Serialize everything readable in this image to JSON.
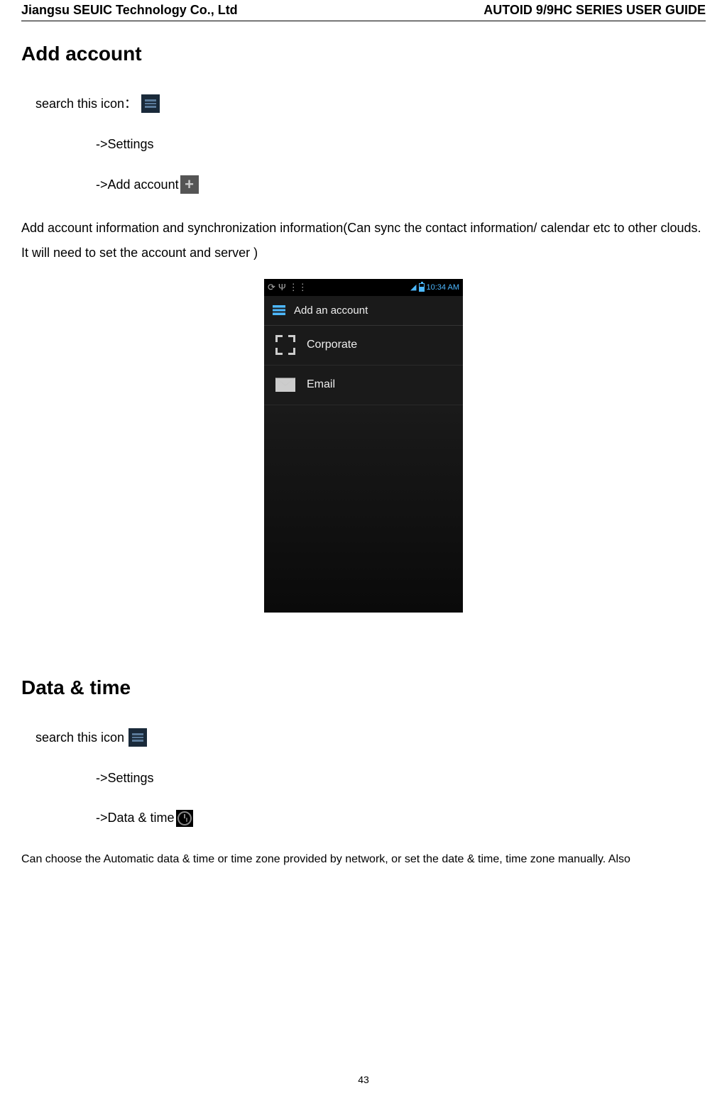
{
  "header": {
    "left": "Jiangsu SEUIC Technology Co., Ltd",
    "right": "AUTOID 9/9HC SERIES USER GUIDE"
  },
  "section1": {
    "title": "Add account",
    "step1_text": "search this icon：",
    "step2_text": "->Settings",
    "step3_text": "->Add account",
    "body": "Add account information and synchronization information(Can sync the contact information/ calendar etc to other clouds. It will need to set the account and server )"
  },
  "screenshot": {
    "status_time": "10:34 AM",
    "title": "Add an account",
    "rows": [
      {
        "label": "Corporate"
      },
      {
        "label": "Email"
      }
    ]
  },
  "section2": {
    "title": "Data & time",
    "step1_text": "search this icon",
    "step2_text": "->Settings",
    "step3_text": "->Data & time",
    "body": "Can choose the Automatic data & time or time zone provided by network, or set the date & time, time zone manually. Also"
  },
  "page_number": "43"
}
